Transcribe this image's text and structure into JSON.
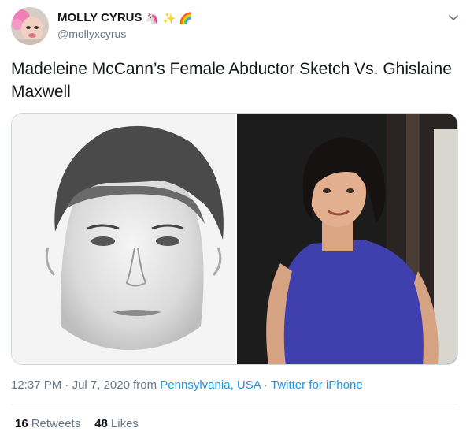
{
  "user": {
    "display_name": "MOLLY CYRUS",
    "emojis": [
      "🦄",
      "✨",
      "🌈"
    ],
    "handle": "@mollyxcyrus"
  },
  "tweet": {
    "text": "Madeleine McCann’s Female Abductor Sketch Vs. Ghislaine Maxwell"
  },
  "meta": {
    "time": "12:37 PM",
    "sep1": " · ",
    "date": "Jul 7, 2020",
    "from_label": " from ",
    "location": "Pennsylvania, USA",
    "sep2": " · ",
    "source": "Twitter for iPhone"
  },
  "stats": {
    "retweets_count": "16",
    "retweets_label": "Retweets",
    "likes_count": "48",
    "likes_label": "Likes"
  },
  "colors": {
    "text": "#14171a",
    "secondary": "#657786",
    "link": "#1b95e0",
    "border": "#ccd6dd"
  },
  "icons": {
    "menu": "chevron-down-icon"
  }
}
